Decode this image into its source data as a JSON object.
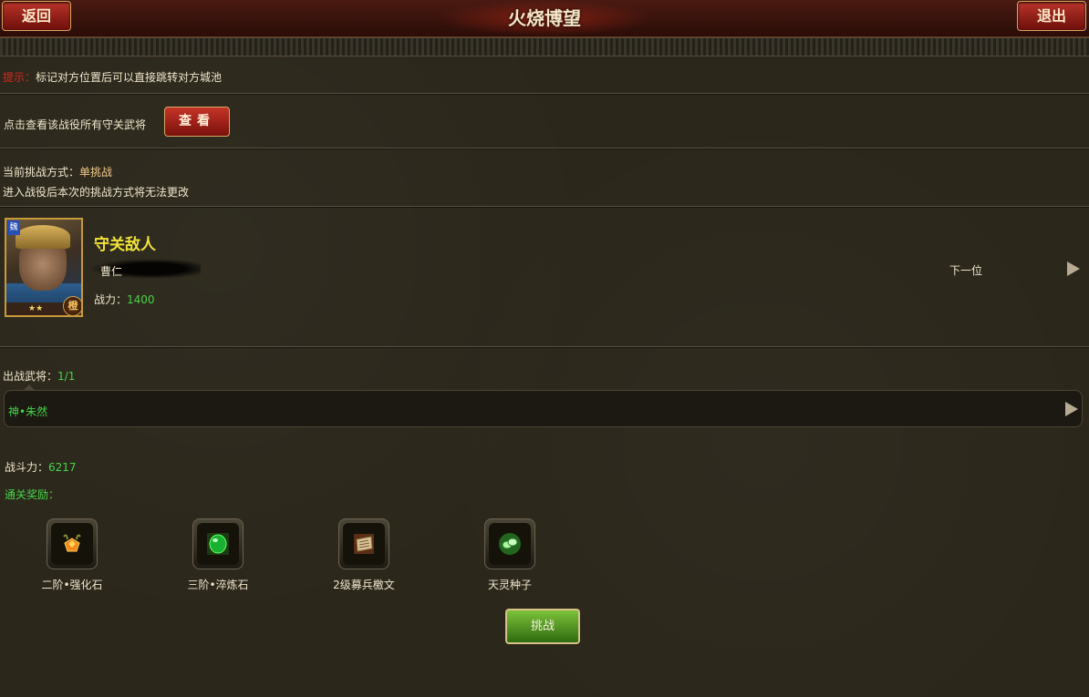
{
  "header": {
    "title": "火烧博望",
    "back_label": "返回",
    "exit_label": "退出"
  },
  "tip": {
    "prefix": "提示：",
    "text": "标记对方位置后可以直接跳转对方城池"
  },
  "view_section": {
    "text": "点击查看该战役所有守关武将",
    "button_label": "查看"
  },
  "challenge_mode": {
    "label": "当前挑战方式：",
    "value": "单挑战",
    "note": "进入战役后本次的挑战方式将无法更改"
  },
  "enemy": {
    "title": "守关敌人",
    "name": "曹仁",
    "power_label": "战力：",
    "power_value": "1400",
    "next_label": "下一位",
    "faction_badge": "魏",
    "grade_badge": "橙",
    "stars": "★★"
  },
  "hero": {
    "label": "出战武将：",
    "count": "1/1",
    "name": "神•朱然"
  },
  "battle_power": {
    "label": "战斗力：",
    "value": "6217"
  },
  "rewards": {
    "label": "通关奖励：",
    "items": [
      {
        "name": "二阶•强化石",
        "icon": "orange-stone-icon"
      },
      {
        "name": "三阶•淬炼石",
        "icon": "green-gem-icon"
      },
      {
        "name": "2级募兵檄文",
        "icon": "scroll-icon"
      },
      {
        "name": "天灵种子",
        "icon": "seed-icon"
      }
    ]
  },
  "challenge_button": "挑战",
  "colors": {
    "tip_red": "#e0261a",
    "value_green": "#47d447",
    "title_yellow": "#f2e23a",
    "header_red": "#6e0f0b"
  }
}
